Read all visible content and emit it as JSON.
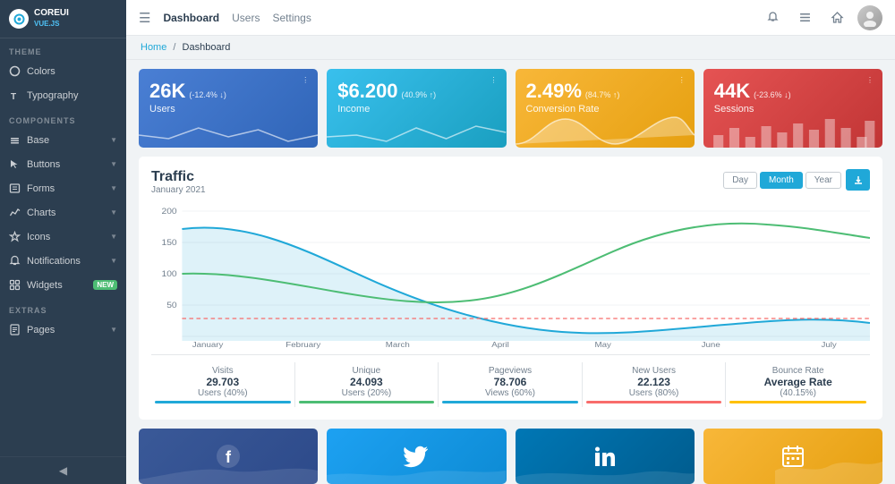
{
  "sidebar": {
    "logo_text": "COREUI",
    "logo_sub": "VUE.JS",
    "sections": [
      {
        "label": "THEME",
        "items": [
          {
            "id": "colors",
            "label": "Colors",
            "icon": "circle",
            "badge": null,
            "chevron": false
          },
          {
            "id": "typography",
            "label": "Typography",
            "icon": "font",
            "badge": null,
            "chevron": false
          }
        ]
      },
      {
        "label": "COMPONENTS",
        "items": [
          {
            "id": "base",
            "label": "Base",
            "icon": "layers",
            "badge": null,
            "chevron": true
          },
          {
            "id": "buttons",
            "label": "Buttons",
            "icon": "cursor",
            "badge": null,
            "chevron": true
          },
          {
            "id": "forms",
            "label": "Forms",
            "icon": "form",
            "badge": null,
            "chevron": true
          },
          {
            "id": "charts",
            "label": "Charts",
            "icon": "chart",
            "badge": null,
            "chevron": true
          },
          {
            "id": "icons",
            "label": "Icons",
            "icon": "star",
            "badge": null,
            "chevron": true
          },
          {
            "id": "notifications",
            "label": "Notifications",
            "icon": "bell",
            "badge": null,
            "chevron": true
          },
          {
            "id": "widgets",
            "label": "Widgets",
            "icon": "widget",
            "badge": "NEW",
            "chevron": false
          }
        ]
      },
      {
        "label": "EXTRAS",
        "items": [
          {
            "id": "pages",
            "label": "Pages",
            "icon": "page",
            "badge": null,
            "chevron": true
          }
        ]
      }
    ]
  },
  "topbar": {
    "hamburger": "☰",
    "nav_items": [
      {
        "label": "Dashboard",
        "active": true
      },
      {
        "label": "Users",
        "active": false
      },
      {
        "label": "Settings",
        "active": false
      }
    ]
  },
  "breadcrumb": {
    "home": "Home",
    "sep": "/",
    "current": "Dashboard"
  },
  "stat_cards": [
    {
      "value": "26K",
      "change": "(-12.4% ↓)",
      "label": "Users",
      "color": "blue"
    },
    {
      "value": "$6.200",
      "change": "(40.9% ↑)",
      "label": "Income",
      "color": "teal"
    },
    {
      "value": "2.49%",
      "change": "(84.7% ↑)",
      "label": "Conversion Rate",
      "color": "yellow"
    },
    {
      "value": "44K",
      "change": "(-23.6% ↓)",
      "label": "Sessions",
      "color": "red"
    }
  ],
  "traffic": {
    "title": "Traffic",
    "subtitle": "January 2021",
    "controls": {
      "day": "Day",
      "month": "Month",
      "year": "Year"
    },
    "y_labels": [
      "200",
      "150",
      "100",
      "50"
    ],
    "x_labels": [
      "January",
      "February",
      "March",
      "April",
      "May",
      "June",
      "July"
    ],
    "stats": [
      {
        "label": "Visits",
        "value": "29.703",
        "sub": "Users (40%)",
        "color": "#20a8d8"
      },
      {
        "label": "Unique",
        "value": "24.093",
        "sub": "Users (20%)",
        "color": "#4dbd74"
      },
      {
        "label": "Pageviews",
        "value": "78.706",
        "sub": "Views (60%)",
        "color": "#20a8d8"
      },
      {
        "label": "New Users",
        "value": "22.123",
        "sub": "Users (80%)",
        "color": "#f86c6b"
      },
      {
        "label": "Bounce Rate",
        "value": "Average Rate",
        "sub": "(40.15%)",
        "color": "#ffc107"
      }
    ]
  },
  "social_cards": [
    {
      "id": "facebook",
      "icon": "f",
      "color": "#3b5998"
    },
    {
      "id": "twitter",
      "icon": "t",
      "color": "#1da1f2"
    },
    {
      "id": "linkedin",
      "icon": "in",
      "color": "#0077b5"
    },
    {
      "id": "calendar",
      "icon": "📅",
      "color": "#f8b739"
    }
  ],
  "dashboard_title": "Dashboard",
  "badge_new": "NEW"
}
